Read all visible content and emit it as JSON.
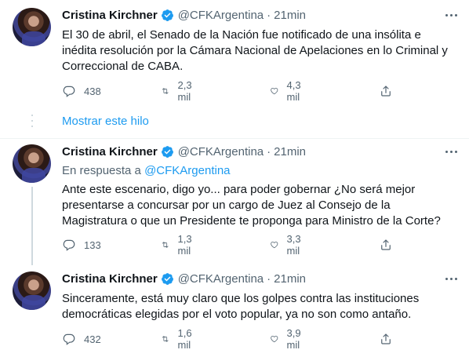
{
  "account": {
    "name": "Cristina Kirchner",
    "handle": "@CFKArgentina"
  },
  "tweets": [
    {
      "time": "21min",
      "text": "El 30 de abril, el Senado de la Nación fue notificado de una insólita e inédita resolución por la Cámara Nacional de Apelaciones en lo Criminal y Correccional de CABA.",
      "replies": "438",
      "retweets": "2,3 mil",
      "likes": "4,3 mil"
    },
    {
      "time": "21min",
      "reply_prefix": "En respuesta a",
      "reply_to": "@CFKArgentina",
      "text": "Ante este escenario, digo yo... para poder gobernar ¿No será mejor presentarse a concursar por un cargo de Juez al Consejo de la Magistratura o que un Presidente te proponga para Ministro de la Corte?",
      "replies": "133",
      "retweets": "1,3 mil",
      "likes": "3,3 mil"
    },
    {
      "time": "21min",
      "text": "Sinceramente, está muy claro que los golpes contra las instituciones democráticas elegidas por el voto popular, ya no son como antaño.",
      "replies": "432",
      "retweets": "1,6 mil",
      "likes": "3,9 mil"
    }
  ],
  "show_thread": "Mostrar este hilo",
  "colors": {
    "accent": "#1d9bf0",
    "text": "#0f1419",
    "muted": "#536471"
  }
}
